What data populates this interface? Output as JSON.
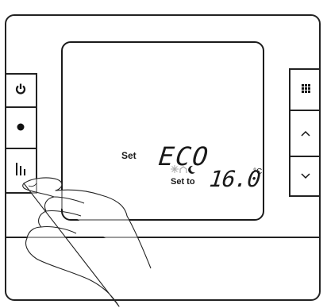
{
  "display": {
    "set_label": "Set",
    "mode": "ECO",
    "set_to_label": "Set to",
    "temperature": "16.0",
    "unit": "°C"
  },
  "left_buttons": [
    {
      "icon": "power-icon"
    },
    {
      "icon": "dot-icon"
    },
    {
      "icon": "schedule-bars-icon"
    }
  ],
  "right_buttons": [
    {
      "icon": "menu-grid-icon"
    },
    {
      "icon": "chevron-up-icon"
    },
    {
      "icon": "chevron-down-icon"
    }
  ]
}
